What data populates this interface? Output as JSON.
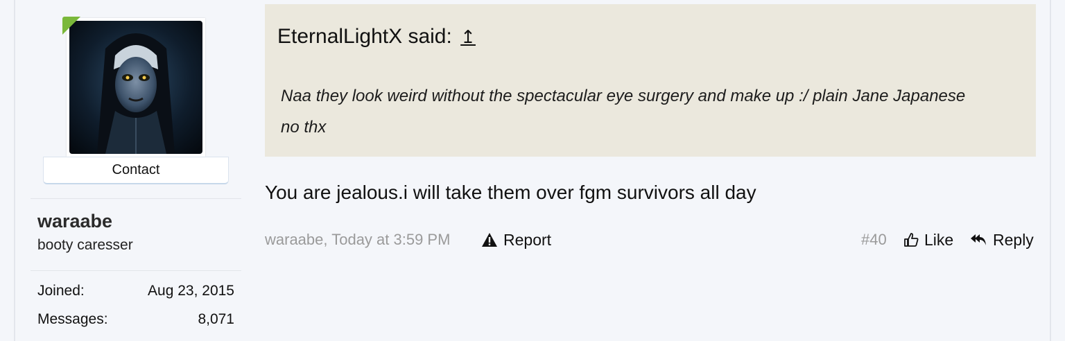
{
  "user": {
    "name": "waraabe",
    "title": "booty caresser",
    "contact_label": "Contact",
    "avatar_icon": "avatar-image",
    "online_color": "#7ab83a",
    "stats": [
      {
        "label": "Joined:",
        "value": "Aug 23, 2015"
      },
      {
        "label": "Messages:",
        "value": "8,071"
      }
    ]
  },
  "quote": {
    "author_line": "EternalLightX said:",
    "jump_glyph": "↥",
    "text": "Naa they look weird without the spectacular eye surgery and make up :/ plain Jane Japanese no thx"
  },
  "message": {
    "text": "You are jealous.i will take them over fgm survivors all day"
  },
  "footer": {
    "meta": "waraabe, Today at 3:59 PM",
    "report_label": "Report",
    "post_number": "#40",
    "like_label": "Like",
    "reply_label": "Reply"
  }
}
